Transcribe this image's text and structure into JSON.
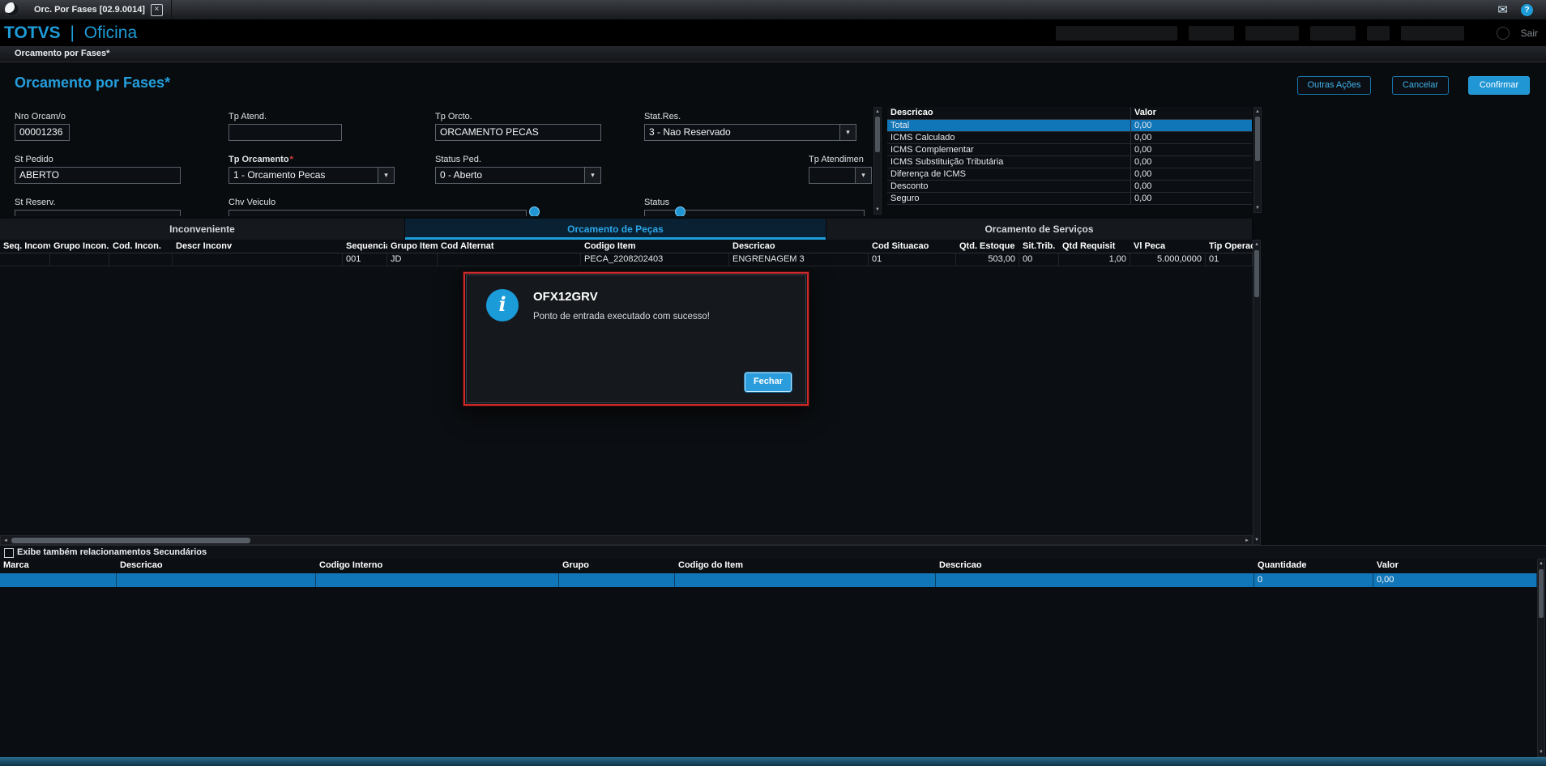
{
  "topbar": {
    "tab_title": "Orc. Por Fases [02.9.0014]"
  },
  "header": {
    "brand": "TOTVS",
    "divider": "|",
    "app": "Oficina",
    "sair": "Sair"
  },
  "breadcrumb": "Orcamento por Fases*",
  "page": {
    "title": "Orcamento por Fases*"
  },
  "toolbar": {
    "outras_acoes": "Outras Ações",
    "cancelar": "Cancelar",
    "confirmar": "Confirmar"
  },
  "form": {
    "nro_orcam": {
      "label": "Nro Orcam/o",
      "value": "00001236"
    },
    "tp_atend": {
      "label": "Tp Atend.",
      "value": ""
    },
    "tp_orcto": {
      "label": "Tp Orcto.",
      "value": "ORCAMENTO PECAS"
    },
    "stat_res": {
      "label": "Stat.Res.",
      "value": "3 - Nao Reservado"
    },
    "st_pedido": {
      "label": "St Pedido",
      "value": "ABERTO"
    },
    "tp_orcamento": {
      "label": "Tp Orcamento",
      "required": "*",
      "value": "1 - Orcamento Pecas"
    },
    "status_ped": {
      "label": "Status Ped.",
      "value": "0 - Aberto"
    },
    "tp_atendimen": {
      "label": "Tp Atendimen",
      "value": ""
    },
    "st_reserv": {
      "label": "St Reserv.",
      "value": ""
    },
    "chv_veiculo": {
      "label": "Chv Veiculo",
      "value": ""
    },
    "status": {
      "label": "Status",
      "value": ""
    }
  },
  "summary": {
    "headers": [
      "Descricao",
      "Valor"
    ],
    "selected": 0,
    "rows": [
      [
        "Total",
        "0,00"
      ],
      [
        "ICMS Calculado",
        "0,00"
      ],
      [
        "ICMS Complementar",
        "0,00"
      ],
      [
        "ICMS Substituição Tributária",
        "0,00"
      ],
      [
        "Diferença de ICMS",
        "0,00"
      ],
      [
        "Desconto",
        "0,00"
      ],
      [
        "Seguro",
        "0,00"
      ]
    ]
  },
  "tabs": [
    {
      "label": "Inconveniente",
      "active": false
    },
    {
      "label": "Orcamento de Peças",
      "active": true
    },
    {
      "label": "Orcamento de Serviços",
      "active": false
    }
  ],
  "parts_table": {
    "headers": [
      "Seq. Inconv.",
      "Grupo Incon.",
      "Cod. Incon.",
      "Descr Inconv",
      "Sequencia",
      "Grupo Item",
      "Cod Alternat",
      "Codigo Item",
      "Descricao",
      "Cod Situacao",
      "Qtd. Estoque",
      "Sit.Trib.",
      "Qtd Requisit",
      "Vl Peca",
      "Tip Operacao"
    ],
    "rows": [
      [
        "",
        "",
        "",
        "",
        "001",
        "JD",
        "",
        "PECA_2208202403",
        "ENGRENAGEM 3",
        "01",
        "503,00",
        "00",
        "1,00",
        "5.000,0000",
        "01"
      ]
    ]
  },
  "dialog": {
    "title": "OFX12GRV",
    "message": "Ponto de entrada executado com sucesso!",
    "close_label": "Fechar"
  },
  "secondary": {
    "checkbox_label": "Exibe também relacionamentos Secundários",
    "checked": false
  },
  "bottom_table": {
    "headers": [
      "Marca",
      "Descricao",
      "Codigo Interno",
      "Grupo",
      "Codigo do Item",
      "Descricao",
      "Quantidade",
      "Valor"
    ],
    "selected": 0,
    "rows": [
      [
        "",
        "",
        "",
        "",
        "",
        "",
        "0",
        "0,00"
      ]
    ]
  },
  "icons": {
    "chevron_down": "▾",
    "close": "×",
    "help": "?",
    "mail": "✉",
    "info": "i",
    "arrow_up": "▲",
    "arrow_down": "▼",
    "arrow_left": "◄",
    "arrow_right": "►"
  },
  "colors": {
    "accent": "#1e9cd7",
    "selection": "#1176b8",
    "confirm_button": "#2196d4",
    "dialog_border": "#cd2a2a"
  }
}
